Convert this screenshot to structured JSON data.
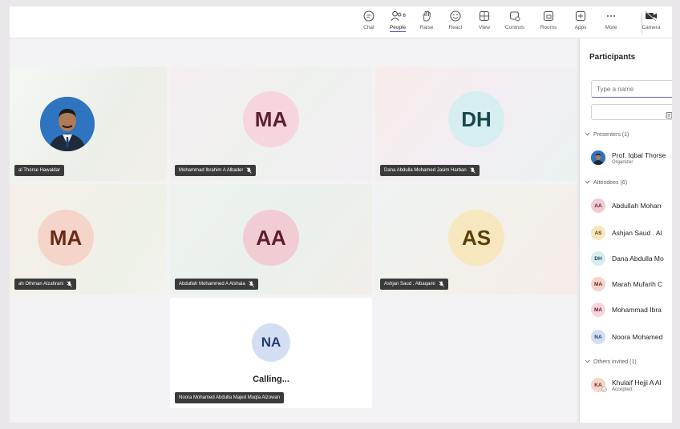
{
  "toolbar": {
    "items": [
      {
        "label": "Chat",
        "icon": "chat-icon"
      },
      {
        "label": "People",
        "badge": "6",
        "icon": "people-icon"
      },
      {
        "label": "Raise",
        "icon": "raise-hand-icon"
      },
      {
        "label": "React",
        "icon": "react-icon"
      },
      {
        "label": "View",
        "icon": "view-icon"
      },
      {
        "label": "Controls",
        "icon": "controls-icon"
      },
      {
        "label": "Rooms",
        "icon": "rooms-icon"
      },
      {
        "label": "Apps",
        "icon": "apps-icon"
      },
      {
        "label": "More",
        "icon": "more-icon"
      },
      {
        "label": "Camera",
        "icon": "camera-off-icon"
      }
    ]
  },
  "tiles": [
    {
      "name": "al Thorse Hawaldar"
    },
    {
      "initials": "MA",
      "name": "Mohammad Ibrahim A Albader",
      "bg": "#f7d5de",
      "fg": "#5a1f2f"
    },
    {
      "initials": "DH",
      "name": "Dana Abdulla Mohamed Jasim Harban",
      "bg": "#d6eef0",
      "fg": "#19464d"
    },
    {
      "initials": "MA",
      "name": "ah Othman Alzahrani",
      "bg": "#f5d4c9",
      "fg": "#6a2a16"
    },
    {
      "initials": "AA",
      "name": "Abdullah Mohammed A Alshaia",
      "bg": "#f1ccd3",
      "fg": "#5f1e2b"
    },
    {
      "initials": "AS",
      "name": "Ashjan Saud . Albaqami",
      "bg": "#f7e7bf",
      "fg": "#5c3f06"
    },
    {
      "initials": "NA",
      "name": "Noora Mohamed Abdulla Majed Muqla Alzowan",
      "bg": "#d4def3",
      "fg": "#233a73",
      "status": "Calling..."
    }
  ],
  "participants": {
    "title": "Participants",
    "search_placeholder": "Type a name",
    "presenters_label": "Presenters (1)",
    "attendees_label": "Attendees (6)",
    "others_label": "Others invited (1)",
    "presenters": [
      {
        "name": "Prof. Iqbal Thorse",
        "sub": "Organizer"
      }
    ],
    "attendees": [
      {
        "initials": "AA",
        "name": "Abdullah Mohan",
        "bg": "#f1ccd3",
        "fg": "#5f1e2b"
      },
      {
        "initials": "AS",
        "name": "Ashjan Saud . Al",
        "bg": "#f7e7bf",
        "fg": "#5c3f06"
      },
      {
        "initials": "DH",
        "name": "Dana Abdulla Mo",
        "bg": "#d6eef0",
        "fg": "#19464d"
      },
      {
        "initials": "MA",
        "name": "Marah Mufarih C",
        "bg": "#f5d4c9",
        "fg": "#6a2a16"
      },
      {
        "initials": "MA",
        "name": "Mohammad Ibra",
        "bg": "#f7d5de",
        "fg": "#5a1f2f"
      },
      {
        "initials": "NA",
        "name": "Noora Mohamed",
        "bg": "#d4def3",
        "fg": "#233a73"
      }
    ],
    "others": [
      {
        "initials": "KA",
        "name": "Khulaif Hejji A Al",
        "sub": "Accepted",
        "bg": "#f5d4c9",
        "fg": "#6a2a16"
      }
    ]
  }
}
